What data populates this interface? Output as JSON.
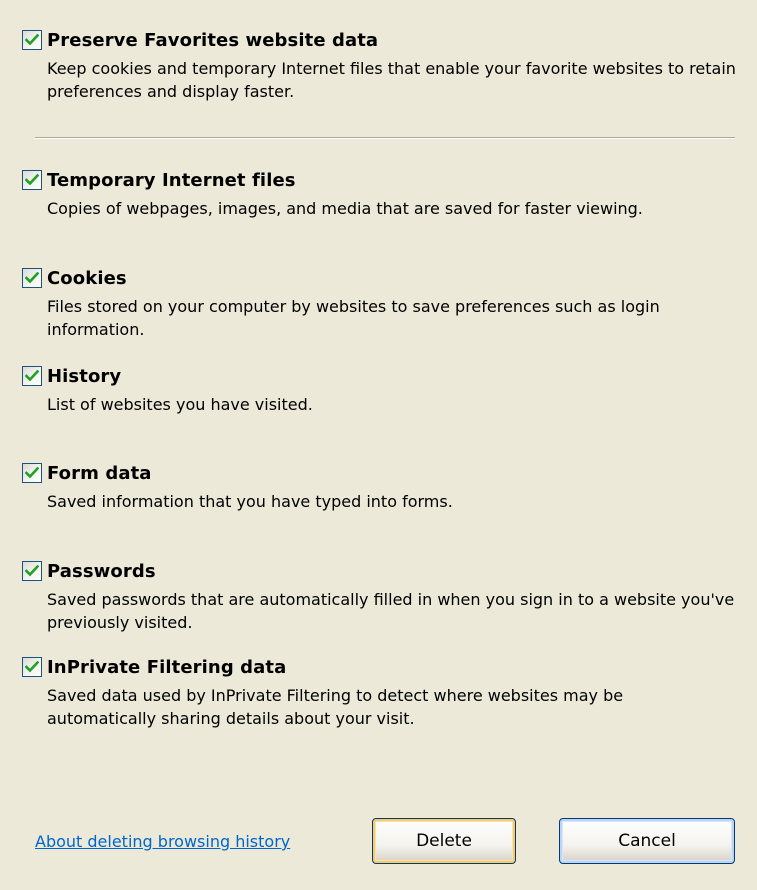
{
  "options": [
    {
      "title": "Preserve Favorites website data",
      "description": "Keep cookies and temporary Internet files that enable your favorite websites to retain preferences and display faster.",
      "checked": true
    },
    {
      "title": "Temporary Internet files",
      "description": "Copies of webpages, images, and media that are saved for faster viewing.",
      "checked": true
    },
    {
      "title": "Cookies",
      "description": "Files stored on your computer by websites to save preferences such as login information.",
      "checked": true
    },
    {
      "title": "History",
      "description": "List of websites you have visited.",
      "checked": true
    },
    {
      "title": "Form data",
      "description": "Saved information that you have typed into forms.",
      "checked": true
    },
    {
      "title": "Passwords",
      "description": "Saved passwords that are automatically filled in when you sign in to a website you've previously visited.",
      "checked": true
    },
    {
      "title": "InPrivate Filtering data",
      "description": "Saved data used by InPrivate Filtering to detect where websites may be automatically sharing details about your visit.",
      "checked": true
    }
  ],
  "footer": {
    "link_label": "About deleting browsing history",
    "delete_label": "Delete",
    "cancel_label": "Cancel"
  },
  "colors": {
    "background": "#ECE9D8",
    "checkmark": "#21A121",
    "checkbox_border": "#1C5180",
    "link": "#0066CC",
    "button_border": "#003C74"
  },
  "icons": {
    "checkbox": "checkmark-icon"
  }
}
